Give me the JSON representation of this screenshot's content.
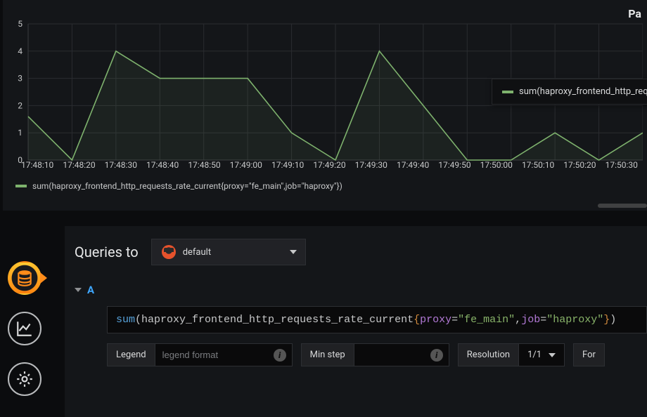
{
  "panel": {
    "title_fragment": "Pa",
    "legend_text": "sum(haproxy_frontend_http_requests_rate_current{proxy=\"fe_main\",job=\"haproxy\"})",
    "tooltip_legend_text": "sum(haproxy_frontend_http_req"
  },
  "chart_data": {
    "type": "line",
    "title": "",
    "xlabel": "",
    "ylabel": "",
    "ylim": [
      0,
      5
    ],
    "yticks": [
      0,
      1,
      2,
      3,
      4,
      5
    ],
    "categories": [
      "17:48:10",
      "17:48:20",
      "17:48:30",
      "17:48:40",
      "17:48:50",
      "17:49:00",
      "17:49:10",
      "17:49:20",
      "17:49:30",
      "17:49:40",
      "17:49:50",
      "17:50:00",
      "17:50:10",
      "17:50:20",
      "17:50:30"
    ],
    "series": [
      {
        "name": "sum(haproxy_frontend_http_requests_rate_current{proxy=\"fe_main\",job=\"haproxy\"})",
        "color": "#7eb26d",
        "values": [
          1.6,
          0,
          4,
          3,
          3,
          3,
          1,
          0,
          4,
          2,
          0,
          0,
          1,
          0,
          1
        ]
      }
    ],
    "grid": true,
    "legend_position": "bottom"
  },
  "editor": {
    "queries_to_label": "Queries to",
    "datasource_name": "default",
    "query_letter": "A",
    "query": {
      "fn": "sum",
      "metric": "haproxy_frontend_http_requests_rate_current",
      "labels": [
        {
          "key": "proxy",
          "value": "\"fe_main\""
        },
        {
          "key": "job",
          "value": "\"haproxy\""
        }
      ]
    },
    "options": {
      "legend_label": "Legend",
      "legend_placeholder": "legend format",
      "minstep_label": "Min step",
      "minstep_value": "",
      "resolution_label": "Resolution",
      "resolution_value": "1/1",
      "format_label_fragment": "For"
    }
  },
  "tabs": {
    "queries": "queries",
    "visualization": "visualization",
    "general": "general"
  }
}
